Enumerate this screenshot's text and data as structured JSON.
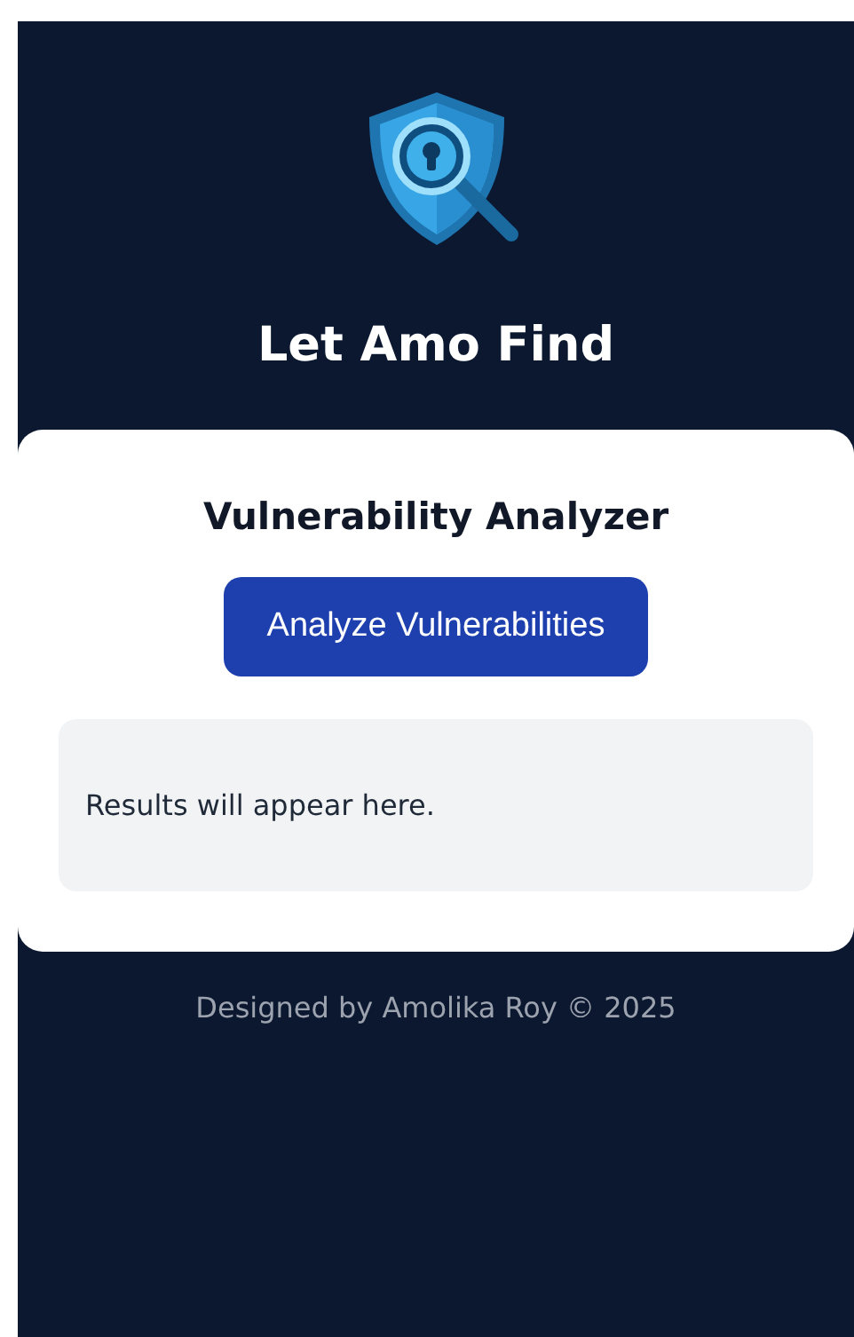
{
  "header": {
    "title": "Let Amo Find"
  },
  "card": {
    "title": "Vulnerability Analyzer",
    "button": "Analyze Vulnerabilities",
    "results": "Results will appear here."
  },
  "footer": "Designed by Amolika Roy © 2025"
}
